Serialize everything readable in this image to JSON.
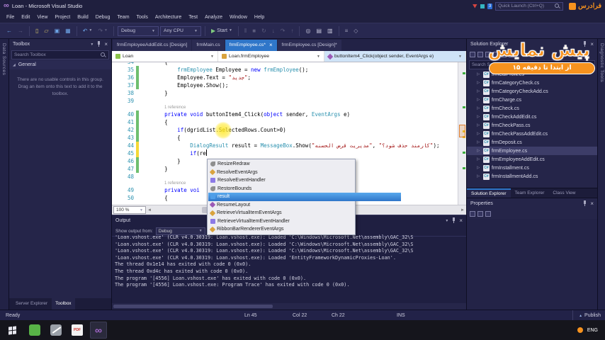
{
  "titlebar": {
    "title": "Loan - Microsoft Visual Studio",
    "badge": "3",
    "quick_launch": "Quick Launch (Ctrl+Q)",
    "brand": "فرادرس"
  },
  "menu": {
    "items": [
      "File",
      "Edit",
      "View",
      "Project",
      "Build",
      "Debug",
      "Team",
      "Tools",
      "Architecture",
      "Test",
      "Analyze",
      "Window",
      "Help"
    ]
  },
  "toolbar": {
    "items": [
      {
        "type": "icon",
        "name": "navigate-back-icon",
        "glyph": "←",
        "color": "#6ea6e8"
      },
      {
        "type": "icon",
        "name": "navigate-forward-icon",
        "glyph": "→",
        "color": "#9a9ab5",
        "disabled": true
      },
      {
        "type": "sep"
      },
      {
        "type": "icon",
        "name": "new-file-icon",
        "glyph": "▯",
        "color": "#d5c36a"
      },
      {
        "type": "icon",
        "name": "open-file-icon",
        "glyph": "▱",
        "color": "#d5c36a"
      },
      {
        "type": "icon",
        "name": "save-icon",
        "glyph": "▣",
        "color": "#6ea6e8"
      },
      {
        "type": "icon",
        "name": "save-all-icon",
        "glyph": "▦",
        "color": "#6ea6e8"
      },
      {
        "type": "sep"
      },
      {
        "type": "icon",
        "name": "undo-icon",
        "glyph": "↶",
        "color": "#6ea6e8",
        "caret": true
      },
      {
        "type": "icon",
        "name": "redo-icon",
        "glyph": "↷",
        "color": "#9a9ab5",
        "caret": true,
        "disabled": true
      },
      {
        "type": "sep"
      },
      {
        "type": "dropdown",
        "name": "solution-configurations-dropdown",
        "label": "Debug"
      },
      {
        "type": "dropdown",
        "name": "solution-platforms-dropdown",
        "label": "Any CPU"
      },
      {
        "type": "sep"
      },
      {
        "type": "icon",
        "name": "start-debug-button",
        "glyph": "▶",
        "color": "#7ec97e",
        "label": "Start",
        "caret": true
      },
      {
        "type": "sep"
      },
      {
        "type": "icon",
        "name": "break-all-icon",
        "glyph": "‖",
        "color": "#9a9ab5",
        "disabled": true
      },
      {
        "type": "icon",
        "name": "stop-debug-icon",
        "glyph": "■",
        "color": "#9a9ab5",
        "disabled": true
      },
      {
        "type": "icon",
        "name": "restart-icon",
        "glyph": "↻",
        "color": "#9a9ab5",
        "disabled": true
      },
      {
        "type": "icon",
        "name": "step-into-icon",
        "glyph": "↓",
        "color": "#9a9ab5",
        "disabled": true
      },
      {
        "type": "icon",
        "name": "step-over-icon",
        "glyph": "↷",
        "color": "#9a9ab5",
        "disabled": true
      },
      {
        "type": "icon",
        "name": "step-out-icon",
        "glyph": "↑",
        "color": "#9a9ab5",
        "disabled": true
      },
      {
        "type": "sep"
      },
      {
        "type": "icon",
        "name": "find-in-files-icon",
        "glyph": "◎",
        "color": "#c5c5da"
      },
      {
        "type": "icon",
        "name": "solution-explorer-icon",
        "glyph": "▤",
        "color": "#c5c5da"
      },
      {
        "type": "icon",
        "name": "properties-window-icon",
        "glyph": "▥",
        "color": "#c5c5da"
      },
      {
        "type": "sep"
      },
      {
        "type": "icon",
        "name": "comment-icon",
        "glyph": "≡",
        "color": "#9a9ab5"
      },
      {
        "type": "icon",
        "name": "bookmark-icon",
        "glyph": "◇",
        "color": "#9a9ab5"
      }
    ]
  },
  "left_strip": {
    "label": "Data Sources"
  },
  "right_strip": {
    "label": "Diagnostic Tools"
  },
  "toolbox": {
    "title": "Toolbox",
    "search_placeholder": "Search Toolbox",
    "section": "General",
    "empty_text": "There are no usable controls in this group. Drag an item onto this text to add it to the toolbox.",
    "bottom_tabs": [
      "Server Explorer",
      "Toolbox"
    ],
    "active_bottom_tab": 1
  },
  "editor": {
    "tabs": [
      {
        "label": "frmEmployeeAddEdit.cs [Design]",
        "active": false
      },
      {
        "label": "frmMain.cs",
        "active": false
      },
      {
        "label": "frmEmployee.cs*",
        "active": true
      },
      {
        "label": "frmEmployee.cs [Design]*",
        "active": false
      }
    ],
    "breadcrumb": {
      "project": "Loan",
      "type": "Loan.frmEmployee",
      "member": "buttonItem4_Click(object sender, EventArgs e)"
    },
    "zoom": "100 %",
    "code": {
      "lines": [
        {
          "n": "34",
          "s": [
            [
              "        {",
              "pln"
            ]
          ]
        },
        {
          "n": "35",
          "m": "g",
          "s": [
            [
              "            ",
              "pln"
            ],
            [
              "frmEmployee",
              "typ"
            ],
            [
              " Employee = ",
              "pln"
            ],
            [
              "new",
              "kw"
            ],
            [
              " ",
              "pln"
            ],
            [
              "frmEmployee",
              "typ"
            ],
            [
              "();",
              "pln"
            ]
          ]
        },
        {
          "n": "36",
          "m": "g",
          "s": [
            [
              "            Employee.Text = ",
              "pln"
            ],
            [
              "\"جدید\"",
              "str"
            ],
            [
              ";",
              "pln"
            ]
          ]
        },
        {
          "n": "37",
          "m": "g",
          "s": [
            [
              "            Employee.Show();",
              "pln"
            ]
          ]
        },
        {
          "n": "38",
          "s": [
            [
              "        }",
              "pln"
            ]
          ]
        },
        {
          "n": "39",
          "s": []
        },
        {
          "lens": "1 re​ference"
        },
        {
          "n": "40",
          "m": "g",
          "s": [
            [
              "        ",
              "pln"
            ],
            [
              "private",
              "kw"
            ],
            [
              " ",
              "pln"
            ],
            [
              "void",
              "kw"
            ],
            [
              " buttonItem4_Click(",
              "pln"
            ],
            [
              "object",
              "kw"
            ],
            [
              " sender, ",
              "pln"
            ],
            [
              "EventArgs",
              "typ"
            ],
            [
              " e)",
              "pln"
            ]
          ]
        },
        {
          "n": "41",
          "m": "g",
          "s": [
            [
              "        {",
              "pln"
            ]
          ]
        },
        {
          "n": "42",
          "m": "g",
          "s": [
            [
              "            ",
              "pln"
            ],
            [
              "if",
              "kw"
            ],
            [
              "(dgridList.SelectedRows.Count>0)",
              "pln"
            ]
          ]
        },
        {
          "n": "43",
          "m": "g",
          "s": [
            [
              "            {",
              "pln"
            ]
          ]
        },
        {
          "n": "44",
          "m": "y",
          "s": [
            [
              "                ",
              "pln"
            ],
            [
              "DialogResult",
              "typ"
            ],
            [
              " result = ",
              "pln"
            ],
            [
              "MessageBox",
              "typ"
            ],
            [
              ".Show(",
              "pln"
            ],
            [
              "\"کارمند حذف شود؟\"",
              "str"
            ],
            [
              " ,",
              "pln"
            ],
            [
              "\"مدیریت قرض الحسنه\"",
              "str"
            ],
            [
              ");",
              "pln"
            ]
          ]
        },
        {
          "n": "45",
          "m": "y",
          "caret": true,
          "s": [
            [
              "                ",
              "pln"
            ],
            [
              "if",
              "kw"
            ],
            [
              "(re",
              "pln"
            ]
          ]
        },
        {
          "n": "46",
          "m": "g",
          "s": [
            [
              "            }",
              "pln"
            ]
          ]
        },
        {
          "n": "47",
          "m": "g",
          "s": [
            [
              "        }",
              "pln"
            ]
          ]
        },
        {
          "n": "48",
          "s": []
        },
        {
          "lens": "1 re​ference"
        },
        {
          "n": "49",
          "s": [
            [
              "        ",
              "pln"
            ],
            [
              "private",
              "kw"
            ],
            [
              " ",
              "pln"
            ],
            [
              "voi",
              "kw"
            ]
          ]
        },
        {
          "n": "50",
          "s": [
            [
              "        {",
              "pln"
            ]
          ]
        }
      ]
    },
    "intellisense": {
      "items": [
        {
          "label": "ResizeRedraw",
          "icon": "property"
        },
        {
          "label": "ResolveEventArgs",
          "icon": "class"
        },
        {
          "label": "ResolveEventHandler",
          "icon": "delegate"
        },
        {
          "label": "RestoreBounds",
          "icon": "property"
        },
        {
          "label": "result",
          "icon": "local",
          "selected": true
        },
        {
          "label": "ResumeLayout",
          "icon": "method"
        },
        {
          "label": "RetrieveVirtualItemEventArgs",
          "icon": "class"
        },
        {
          "label": "RetrieveVirtualItemEventHandler",
          "icon": "delegate"
        },
        {
          "label": "RibbonBarRendererEventArgs",
          "icon": "class"
        }
      ]
    }
  },
  "solution_explorer": {
    "title": "Solution Explorer",
    "search_placeholder": "Search Solution Explorer (Ctrl+;)",
    "toolbar_icons": [
      "home-icon",
      "collapse-all-icon",
      "show-all-files-icon",
      "properties-icon",
      "refresh-icon",
      "sync-with-active-document-icon"
    ],
    "items": [
      "frmCalProfit.cs",
      "frmCategoryCheck.cs",
      "frmCategoryCheckAdd.cs",
      "frmCharge.cs",
      "frmCheck.cs",
      "frmCheckAddEdit.cs",
      "frmCheckPass.cs",
      "frmCheckPassAddEdit.cs",
      "frmDeposit.cs",
      "frmEmployee.cs",
      "frmEmployeeAddEdit.cs",
      "frmInstallment.cs",
      "frmInstallmentAdd.cs"
    ],
    "selected": "frmEmployee.cs",
    "tabs": [
      "Solution Explorer",
      "Team Explorer",
      "Class View"
    ],
    "active_tab": 0
  },
  "properties_panel": {
    "title": "Properties",
    "toolbar_icons": [
      "categorized-icon",
      "alphabetical-icon",
      "property-pages-icon"
    ]
  },
  "output": {
    "title": "Output",
    "show_from_label": "Show output from:",
    "source": "Debug",
    "toolbar_icons": [
      "find-icon",
      "clear-all-icon",
      "word-wrap-icon",
      "autoscroll-icon"
    ],
    "lines": [
      "'Loan.vshost.exe' (CLR v4.0.30319: Loan.vshost.exe): Loaded 'C:\\Windows\\Microsoft.Net\\assembly\\GAC_32\\S",
      "'Loan.vshost.exe' (CLR v4.0.30319: Loan.vshost.exe): Loaded 'C:\\Windows\\Microsoft.Net\\assembly\\GAC_32\\S",
      "'Loan.vshost.exe' (CLR v4.0.30319: Loan.vshost.exe): Loaded 'C:\\Windows\\Microsoft.Net\\assembly\\GAC_32\\S",
      "'Loan.vshost.exe' (CLR v4.0.30319: Loan.vshost.exe): Loaded 'EntityFrameworkDynamicProxies-Loan'.",
      "The thread 0x1e14 has exited with code 0 (0x0).",
      "The thread 0xd4c has exited with code 0 (0x0).",
      "The program '[4556] Loan.vshost.exe' has exited with code 0 (0x0).",
      "The program '[4556] Loan.vshost.exe: Program Trace' has exited with code 0 (0x0)."
    ]
  },
  "status_bar": {
    "ready": "Ready",
    "ln": "Ln 45",
    "col": "Col 22",
    "ch": "Ch 22",
    "ins": "INS",
    "publish": "Publish"
  },
  "taskbar": {
    "lang": "ENG",
    "icons": [
      {
        "name": "greenshot-icon",
        "type": "green"
      },
      {
        "name": "utility-app-icon",
        "type": "tool"
      },
      {
        "name": "pdf-reader-icon",
        "type": "pdf",
        "label": "PDF"
      },
      {
        "name": "visual-studio-icon",
        "type": "vs",
        "label": "∞",
        "active": true
      }
    ]
  },
  "watermark": {
    "headline": "پیش نمایش",
    "pill": "از ابتدا تا دقیقه ۱۵"
  }
}
